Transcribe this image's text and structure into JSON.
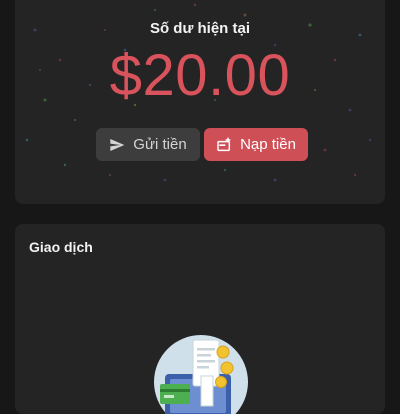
{
  "balance": {
    "title": "Số dư hiện tại",
    "amount": "$20.00"
  },
  "actions": {
    "send_label": "Gửi tiền",
    "send_icon": "send-icon",
    "topup_label": "Nạp tiền",
    "topup_icon": "add-card-icon"
  },
  "transactions": {
    "title": "Giao dịch",
    "empty_icon": "empty-transactions-illustration"
  },
  "colors": {
    "background": "#171717",
    "card": "#242424",
    "accent": "#d9535c",
    "secondary_button": "#3d3d3d"
  }
}
